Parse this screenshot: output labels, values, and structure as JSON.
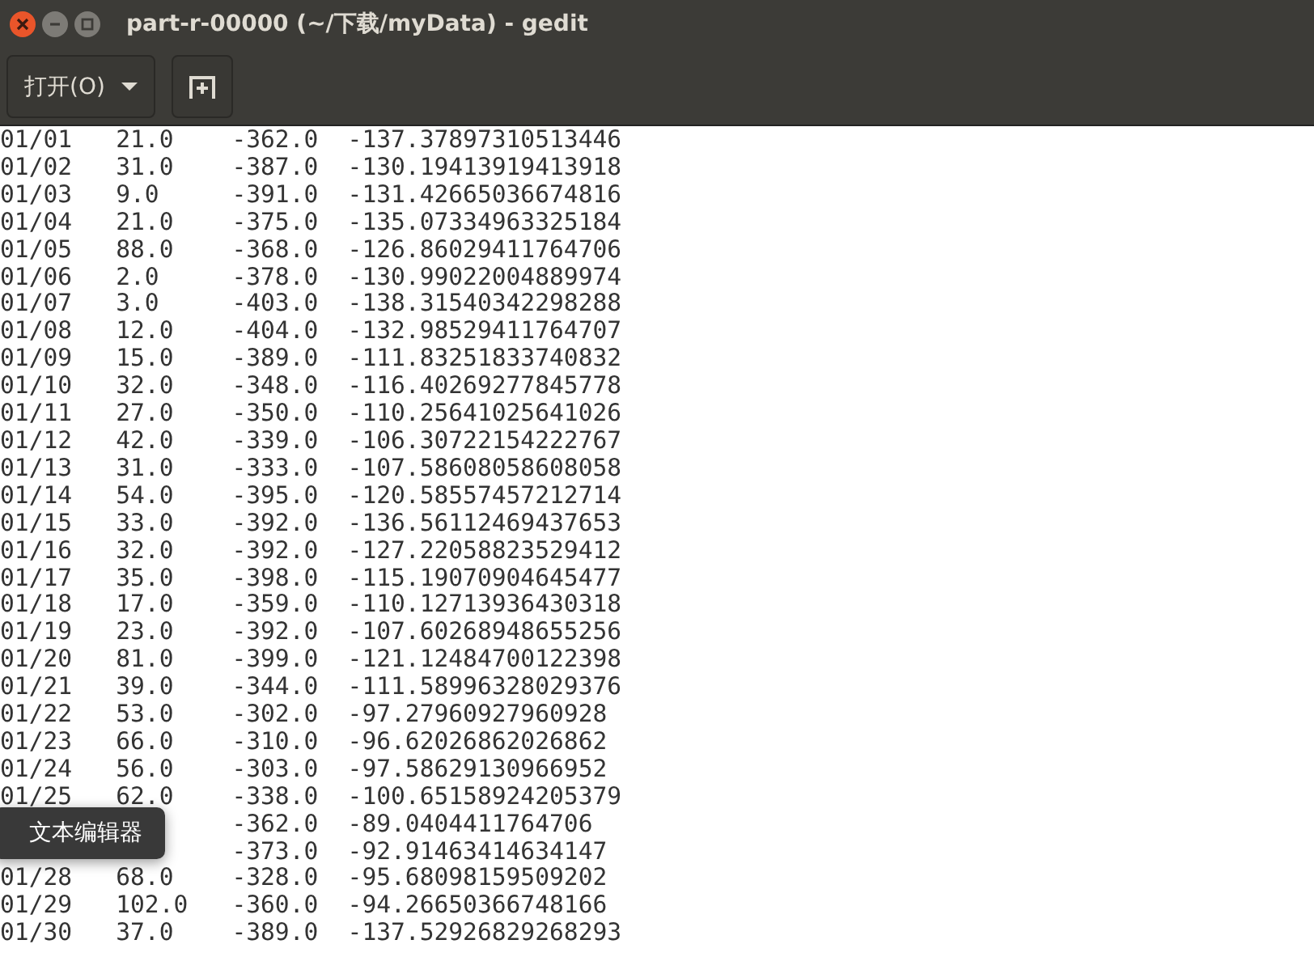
{
  "window": {
    "title": "part-r-00000 (~/下载/myData) - gedit"
  },
  "toolbar": {
    "open_button": {
      "label": "打开(O)"
    }
  },
  "document": {
    "rows": [
      {
        "column_1": "01/01",
        "column_2": "21.0",
        "column_3": "-362.0",
        "column_4": "-137.37897310513446"
      },
      {
        "column_1": "01/02",
        "column_2": "31.0",
        "column_3": "-387.0",
        "column_4": "-130.19413919413918"
      },
      {
        "column_1": "01/03",
        "column_2": "9.0",
        "column_3": "-391.0",
        "column_4": "-131.42665036674816"
      },
      {
        "column_1": "01/04",
        "column_2": "21.0",
        "column_3": "-375.0",
        "column_4": "-135.07334963325184"
      },
      {
        "column_1": "01/05",
        "column_2": "88.0",
        "column_3": "-368.0",
        "column_4": "-126.86029411764706"
      },
      {
        "column_1": "01/06",
        "column_2": "2.0",
        "column_3": "-378.0",
        "column_4": "-130.99022004889974"
      },
      {
        "column_1": "01/07",
        "column_2": "3.0",
        "column_3": "-403.0",
        "column_4": "-138.31540342298288"
      },
      {
        "column_1": "01/08",
        "column_2": "12.0",
        "column_3": "-404.0",
        "column_4": "-132.98529411764707"
      },
      {
        "column_1": "01/09",
        "column_2": "15.0",
        "column_3": "-389.0",
        "column_4": "-111.83251833740832"
      },
      {
        "column_1": "01/10",
        "column_2": "32.0",
        "column_3": "-348.0",
        "column_4": "-116.40269277845778"
      },
      {
        "column_1": "01/11",
        "column_2": "27.0",
        "column_3": "-350.0",
        "column_4": "-110.25641025641026"
      },
      {
        "column_1": "01/12",
        "column_2": "42.0",
        "column_3": "-339.0",
        "column_4": "-106.30722154222767"
      },
      {
        "column_1": "01/13",
        "column_2": "31.0",
        "column_3": "-333.0",
        "column_4": "-107.58608058608058"
      },
      {
        "column_1": "01/14",
        "column_2": "54.0",
        "column_3": "-395.0",
        "column_4": "-120.58557457212714"
      },
      {
        "column_1": "01/15",
        "column_2": "33.0",
        "column_3": "-392.0",
        "column_4": "-136.56112469437653"
      },
      {
        "column_1": "01/16",
        "column_2": "32.0",
        "column_3": "-392.0",
        "column_4": "-127.22058823529412"
      },
      {
        "column_1": "01/17",
        "column_2": "35.0",
        "column_3": "-398.0",
        "column_4": "-115.19070904645477"
      },
      {
        "column_1": "01/18",
        "column_2": "17.0",
        "column_3": "-359.0",
        "column_4": "-110.12713936430318"
      },
      {
        "column_1": "01/19",
        "column_2": "23.0",
        "column_3": "-392.0",
        "column_4": "-107.60268948655256"
      },
      {
        "column_1": "01/20",
        "column_2": "81.0",
        "column_3": "-399.0",
        "column_4": "-121.12484700122398"
      },
      {
        "column_1": "01/21",
        "column_2": "39.0",
        "column_3": "-344.0",
        "column_4": "-111.58996328029376"
      },
      {
        "column_1": "01/22",
        "column_2": "53.0",
        "column_3": "-302.0",
        "column_4": "-97.27960927960928"
      },
      {
        "column_1": "01/23",
        "column_2": "66.0",
        "column_3": "-310.0",
        "column_4": "-96.62026862026862"
      },
      {
        "column_1": "01/24",
        "column_2": "56.0",
        "column_3": "-303.0",
        "column_4": "-97.58629130966952"
      },
      {
        "column_1": "01/25",
        "column_2": "62.0",
        "column_3": "-338.0",
        "column_4": "-100.65158924205379"
      },
      {
        "column_3": "-362.0",
        "column_4": "-89.0404411764706"
      },
      {
        "column_3": "-373.0",
        "column_4": "-92.91463414634147"
      },
      {
        "column_1": "01/28",
        "column_2": "68.0",
        "column_3": "-328.0",
        "column_4": "-95.68098159509202"
      },
      {
        "column_1": "01/29",
        "column_2": "102.0",
        "column_3": "-360.0",
        "column_4": "-94.26650366748166"
      },
      {
        "column_1": "01/30",
        "column_2": "37.0",
        "column_3": "-389.0",
        "column_4": "-137.52926829268293"
      }
    ]
  },
  "tooltip": {
    "text": "文本编辑器"
  }
}
